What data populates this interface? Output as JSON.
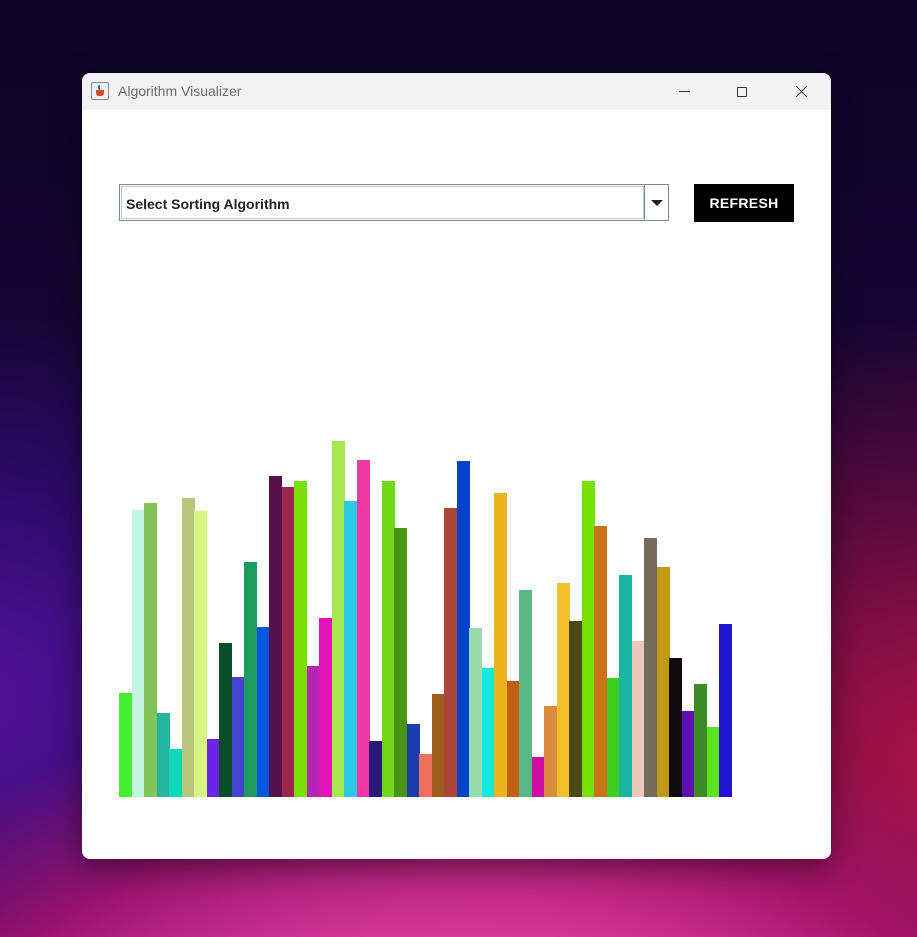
{
  "window": {
    "title": "Algorithm Visualizer"
  },
  "controls": {
    "algorithm_select": {
      "selected": "Select Sorting Algorithm"
    },
    "refresh_label": "REFRESH"
  },
  "chart_data": {
    "type": "bar",
    "title": "",
    "xlabel": "",
    "ylabel": "",
    "ylim": [
      0,
      355
    ],
    "values": [
      104,
      286,
      293,
      84,
      48,
      298,
      285,
      58,
      154,
      120,
      234,
      170,
      320,
      309,
      315,
      131,
      178,
      355,
      295,
      336,
      56,
      315,
      268,
      73,
      43,
      103,
      288,
      335,
      169,
      129,
      303,
      116,
      206,
      40,
      91,
      213,
      176,
      315,
      270,
      119,
      221,
      156,
      258,
      229,
      139,
      86,
      113,
      70,
      173
    ],
    "colors": [
      "#44ee30",
      "#c2f6e2",
      "#82c458",
      "#26b6a0",
      "#0fd8b8",
      "#b6c67c",
      "#d7f580",
      "#6a24e6",
      "#0a4e28",
      "#4344d0",
      "#1e9c60",
      "#0058e0",
      "#56104a",
      "#9e2450",
      "#78e002",
      "#b426b2",
      "#e012b8",
      "#a6e850",
      "#2acae6",
      "#ee38a4",
      "#2a1a78",
      "#70d816",
      "#4a9414",
      "#1a3eac",
      "#f07060",
      "#a05c1c",
      "#ac4438",
      "#0444cc",
      "#96dcac",
      "#16eadd",
      "#ecb41c",
      "#c06010",
      "#58b886",
      "#d00ca2",
      "#d88c3c",
      "#f2c02c",
      "#4a4a16",
      "#78e002",
      "#c87414",
      "#3cd01c",
      "#18b6a0",
      "#ecc8bc",
      "#746c58",
      "#c09a14",
      "#100a10",
      "#5c10b0",
      "#3c8c26",
      "#5ee41e",
      "#2016d0",
      "#5c10a8"
    ]
  }
}
